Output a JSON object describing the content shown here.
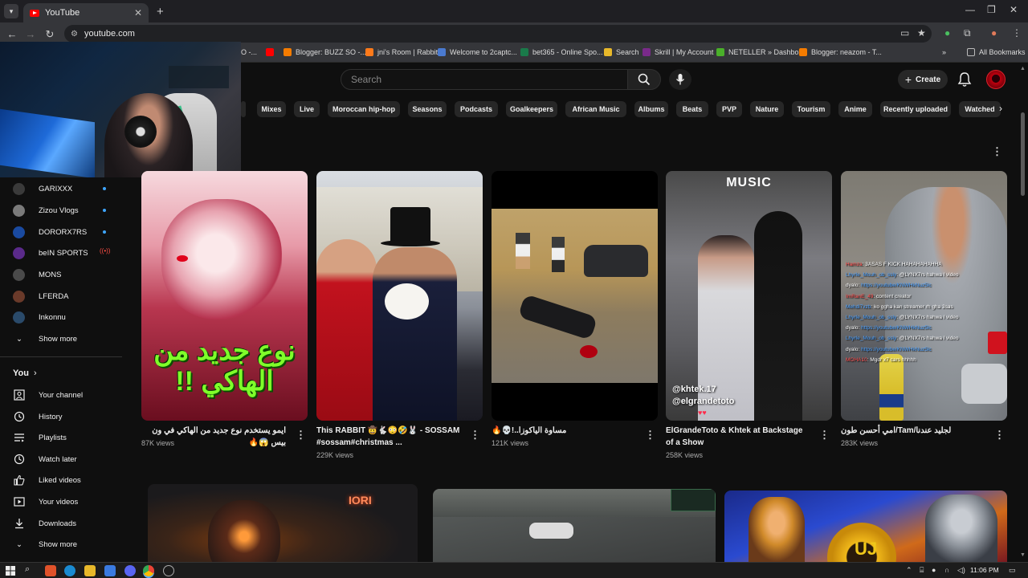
{
  "browser": {
    "tab_title": "YouTube",
    "url": "youtube.com",
    "bookmarks": [
      "O -...",
      "Blogger: BUZZ SO -...",
      "jni's Room | Rabbit",
      "Welcome to 2captc...",
      "bet365 - Online Spo...",
      "Search",
      "Skrill | My Account",
      "NETELLER » Dashbo...",
      "Blogger: neazom - T...",
      "All Bookmarks"
    ]
  },
  "header": {
    "search_placeholder": "Search",
    "create_label": "Create"
  },
  "chips": [
    "Mixes",
    "Live",
    "Moroccan hip-hop",
    "Seasons",
    "Podcasts",
    "Goalkeepers",
    "African Music",
    "Albums",
    "Beats",
    "PVP",
    "Nature",
    "Tourism",
    "Anime",
    "Recently uploaded",
    "Watched"
  ],
  "subscriptions": [
    {
      "name": "GARIXXX",
      "color": "#3a3a3a",
      "status": "new"
    },
    {
      "name": "Zizou Vlogs",
      "color": "#7a7a7a",
      "status": "new"
    },
    {
      "name": "DORORX7RS",
      "color": "#1a4aa0",
      "status": "new"
    },
    {
      "name": "beIN SPORTS",
      "color": "#5a2a8a",
      "status": "live"
    },
    {
      "name": "MONS",
      "color": "#4a4a4a",
      "status": ""
    },
    {
      "name": "LFERDA",
      "color": "#6a3a2a",
      "status": ""
    },
    {
      "name": "Inkonnu",
      "color": "#2a4a6a",
      "status": ""
    }
  ],
  "subs_show_more": "Show more",
  "you_section": {
    "heading": "You",
    "items": [
      {
        "label": "Your channel",
        "icon": "channel-icon"
      },
      {
        "label": "History",
        "icon": "history-icon"
      },
      {
        "label": "Playlists",
        "icon": "playlists-icon"
      },
      {
        "label": "Watch later",
        "icon": "watch-later-icon"
      },
      {
        "label": "Liked videos",
        "icon": "like-icon"
      },
      {
        "label": "Your videos",
        "icon": "your-videos-icon"
      },
      {
        "label": "Downloads",
        "icon": "download-icon"
      },
      {
        "label": "Show more",
        "icon": "chevron-down-icon"
      }
    ]
  },
  "shorts": [
    {
      "title": "ايمو يستخدم نوع جديد من الهاكي في ون بيس 😱🔥",
      "views": "87K views",
      "overlay": "نوع جديد من الهاكي !!"
    },
    {
      "title": "This RABBIT 🤠🐇😳🤣🐰 - SOSSAM #sossam#christmas ...",
      "views": "229K views"
    },
    {
      "title": "مساوة الياكوزا..!💀🔥",
      "views": "121K views"
    },
    {
      "title": "ElGrandeToto & Khtek at Backstage of a Show",
      "views": "258K views",
      "overlay_logo": "MUSIC",
      "tag1": "@khtek.17",
      "tag2": "@elgrandetoto"
    },
    {
      "title": "لجليد عندنا/Tam/امي أحسن طون",
      "views": "283K views"
    }
  ],
  "short5_chat": [
    {
      "user": "Hamza",
      "msg": "3ASAS F KICK HAHAHAHAHHA"
    },
    {
      "user": "Lhyrle_Mouh_ob_ssly",
      "msg": "@LYNX7rs hahwa l video"
    },
    {
      "user": "dyalo",
      "msg": "https://youtube/KNWHkNuz5lc"
    },
    {
      "user": "ImRanE_49",
      "msg": "content creator"
    },
    {
      "user": "Mehdi7xzb",
      "msg": "ko ggha kan streamer rh gha 3sas"
    },
    {
      "user": "Lhyrle_Mouh_ob_ssly",
      "msg": "@LYNX7rs hahwa l video"
    },
    {
      "user": "dyalo",
      "msg": "https://youtube/KNWHkNuz5lc"
    },
    {
      "user": "Lhyrle_Mouh_ob_ssly",
      "msg": "@LYNX7rs hahwa l video"
    },
    {
      "user": "dyalo",
      "msg": "https://youtube/KNWHkNuz5lc"
    },
    {
      "user": "MOHA10",
      "msg": "Mgdr x7 cars hhhhh"
    }
  ],
  "row2_overlay": "IORI",
  "row2_coin": "UJ",
  "taskbar": {
    "clock": "11:06 PM"
  }
}
